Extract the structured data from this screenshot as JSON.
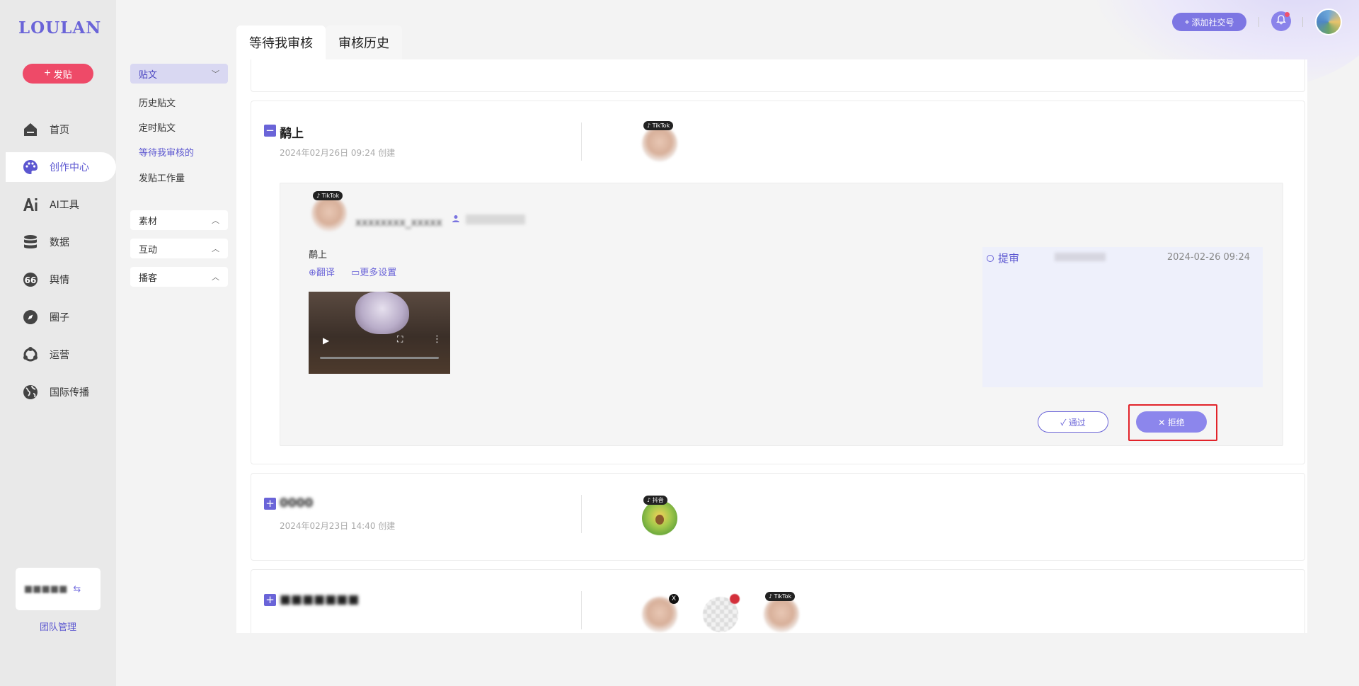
{
  "brand": {
    "logo": "LOULAN"
  },
  "sidebar": {
    "post_button": "发贴",
    "items": [
      {
        "label": "首页",
        "icon": "home-icon"
      },
      {
        "label": "创作中心",
        "icon": "palette-icon"
      },
      {
        "label": "AI工具",
        "icon": "ai-icon"
      },
      {
        "label": "数据",
        "icon": "database-icon"
      },
      {
        "label": "舆情",
        "icon": "quote-icon"
      },
      {
        "label": "圈子",
        "icon": "compass-icon"
      },
      {
        "label": "运营",
        "icon": "operations-icon"
      },
      {
        "label": "国际传播",
        "icon": "globe-icon"
      }
    ],
    "team_mgmt": "团队管理"
  },
  "subnav": {
    "sections": [
      {
        "label": "贴文",
        "expanded": true
      },
      {
        "label": "素材",
        "expanded": false
      },
      {
        "label": "互动",
        "expanded": false
      },
      {
        "label": "播客",
        "expanded": false
      }
    ],
    "links": [
      "历史贴文",
      "定时贴文",
      "等待我审核的",
      "发贴工作量"
    ]
  },
  "header": {
    "add_social": "添加社交号"
  },
  "tabs": [
    "等待我审核",
    "审核历史"
  ],
  "cards": [
    {
      "title": "鹬上",
      "date": "2024年02月26日 09:24 创建",
      "platform": "TikTok",
      "expanded": true,
      "post_text": "鹬上",
      "translate": "翻译",
      "more_settings": "更多设置",
      "review_label": "提审",
      "review_time": "2024-02-26 09:24",
      "pass_button": "通过",
      "reject_button": "拒绝"
    },
    {
      "date": "2024年02月23日 14:40 创建",
      "platform": "抖音",
      "expanded": false
    },
    {
      "platform": "TikTok",
      "expanded": false
    }
  ],
  "colors": {
    "accent": "#6a64d8",
    "post_button": "#ee4a68",
    "reject_highlight": "#e2232a"
  }
}
